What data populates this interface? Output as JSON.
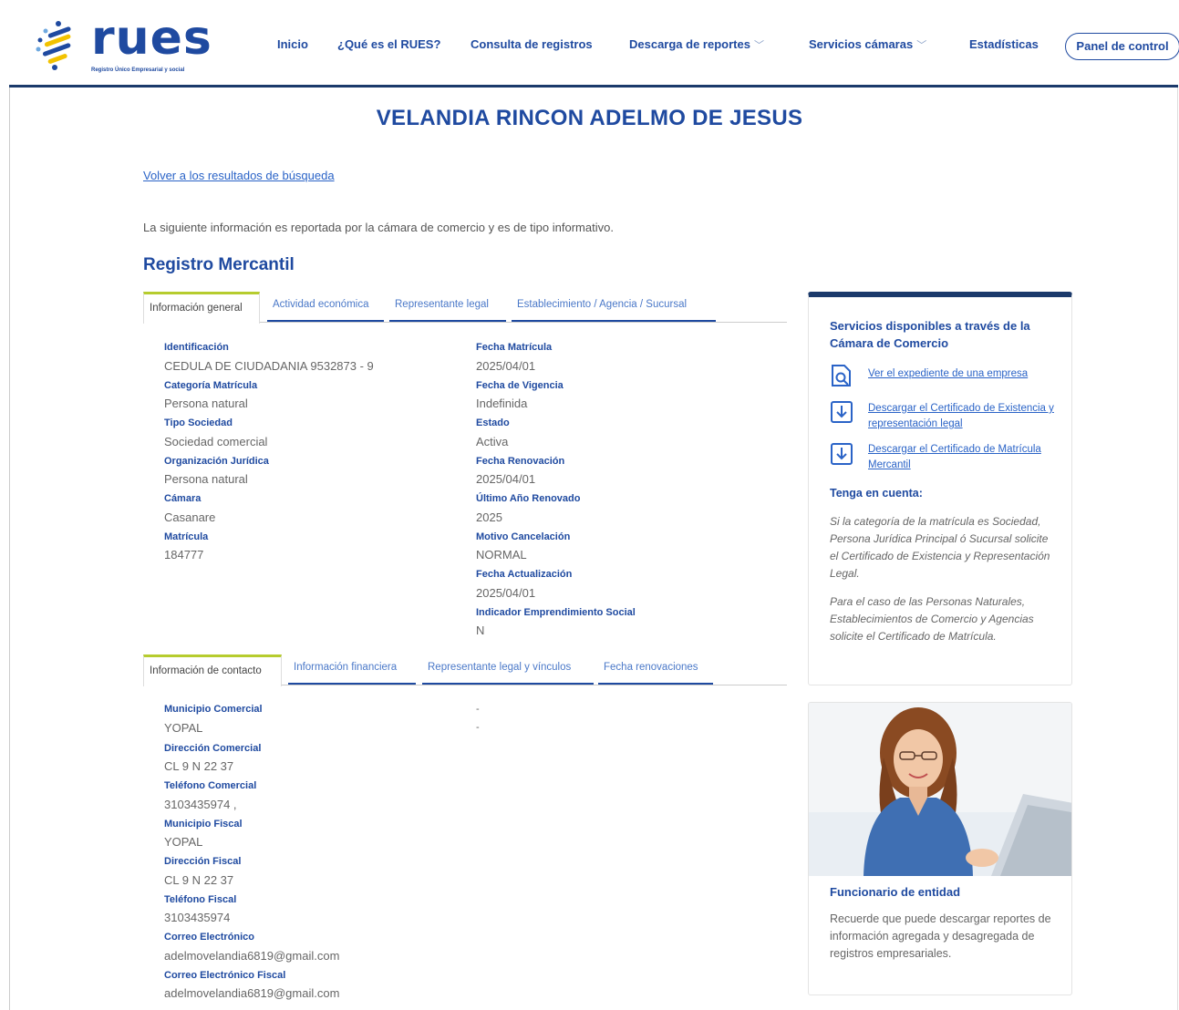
{
  "header": {
    "logo_word": "rues",
    "logo_tagline": "Registro Único Empresarial y social",
    "nav": [
      {
        "label": "Inicio",
        "dropdown": false
      },
      {
        "label": "¿Qué es el RUES?",
        "dropdown": false
      },
      {
        "label": "Consulta de registros",
        "dropdown": false
      },
      {
        "label": "Descarga de reportes",
        "dropdown": true
      },
      {
        "label": "Servicios cámaras",
        "dropdown": true
      },
      {
        "label": "Estadísticas",
        "dropdown": false
      }
    ],
    "panel_button": "Panel de control"
  },
  "page_title": "VELANDIA RINCON ADELMO DE JESUS",
  "back_link": "Volver a los resultados de búsqueda",
  "info_text": "La siguiente información es reportada por la cámara de comercio y es de tipo informativo.",
  "section_title": "Registro Mercantil",
  "tabs1": [
    "Información general",
    "Actividad económica",
    "Representante legal",
    "Establecimiento / Agencia / Sucursal"
  ],
  "general_left": [
    {
      "label": "Identificación",
      "value": "CEDULA DE CIUDADANIA 9532873 - 9"
    },
    {
      "label": "Categoría Matrícula",
      "value": "Persona natural"
    },
    {
      "label": "Tipo Sociedad",
      "value": "Sociedad comercial"
    },
    {
      "label": "Organización Jurídica",
      "value": "Persona natural"
    },
    {
      "label": "Cámara",
      "value": "Casanare"
    },
    {
      "label": "Matrícula",
      "value": "184777"
    }
  ],
  "general_right": [
    {
      "label": "Fecha Matrícula",
      "value": "2025/04/01"
    },
    {
      "label": "Fecha de Vigencia",
      "value": "Indefinida"
    },
    {
      "label": "Estado",
      "value": "Activa"
    },
    {
      "label": "Fecha Renovación",
      "value": "2025/04/01"
    },
    {
      "label": "Último Año Renovado",
      "value": "2025"
    },
    {
      "label": "Motivo Cancelación",
      "value": "NORMAL"
    },
    {
      "label": "Fecha Actualización",
      "value": "2025/04/01"
    },
    {
      "label": "Indicador Emprendimiento Social",
      "value": "N"
    }
  ],
  "tabs2": [
    "Información de contacto",
    "Información financiera",
    "Representante legal y vínculos",
    "Fecha renovaciones"
  ],
  "contact_left": [
    {
      "label": "Municipio Comercial",
      "value": "YOPAL"
    },
    {
      "label": "Dirección Comercial",
      "value": "CL 9 N 22 37"
    },
    {
      "label": "Teléfono Comercial",
      "value": "3103435974 ,"
    },
    {
      "label": "Municipio Fiscal",
      "value": "YOPAL"
    },
    {
      "label": "Dirección Fiscal",
      "value": "CL 9 N 22 37"
    },
    {
      "label": "Teléfono Fiscal",
      "value": "3103435974"
    },
    {
      "label": "Correo Electrónico",
      "value": "adelmovelandia6819@gmail.com"
    },
    {
      "label": "Correo Electrónico Fiscal",
      "value": "adelmovelandia6819@gmail.com"
    }
  ],
  "contact_right": [
    "-",
    "-"
  ],
  "services_card": {
    "title": "Servicios disponibles a través de la Cámara de Comercio",
    "links": [
      {
        "icon": "search-document-icon",
        "text": "Ver el expediente de una empresa"
      },
      {
        "icon": "download-icon",
        "text": "Descargar el Certificado de Existencia y representación legal"
      },
      {
        "icon": "download-icon",
        "text": "Descargar el Certificado de Matrícula Mercantil"
      }
    ],
    "note_title": "Tenga en cuenta:",
    "note_1": "Si la categoría de la matrícula es Sociedad, Persona Jurídica Principal ó Sucursal solicite el Certificado de Existencia y Representación Legal.",
    "note_2": "Para el caso de las Personas Naturales, Establecimientos de Comercio y Agencias solicite el Certificado de Matrícula."
  },
  "officer_card": {
    "title": "Funcionario de entidad",
    "text": "Recuerde que puede descargar reportes de información agregada y desagregada de registros empresariales."
  }
}
